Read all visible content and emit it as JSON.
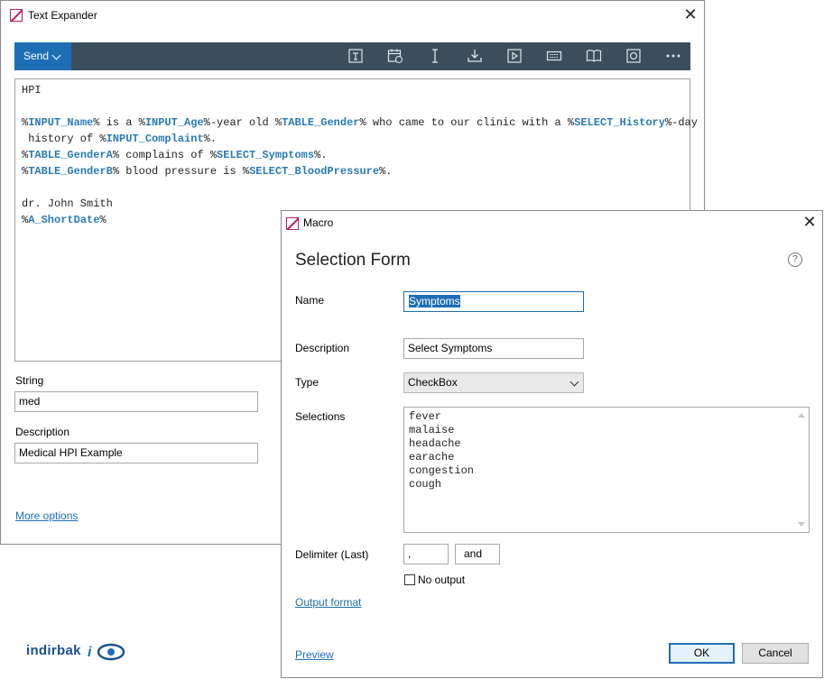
{
  "text_expander": {
    "title": "Text Expander",
    "toolbar": {
      "send_label": "Send",
      "icons": [
        "insert-field-icon",
        "insert-date-icon",
        "text-cursor-icon",
        "download-icon",
        "play-icon",
        "keyboard-icon",
        "book-icon",
        "screenshot-icon",
        "more-icon"
      ]
    },
    "editor_lines": [
      [
        {
          "t": "HPI"
        }
      ],
      [],
      [
        {
          "t": "%"
        },
        {
          "t": "INPUT_Name",
          "v": 1
        },
        {
          "t": "% is a %"
        },
        {
          "t": "INPUT_Age",
          "v": 1
        },
        {
          "t": "%-year old %"
        },
        {
          "t": "TABLE_Gender",
          "v": 1
        },
        {
          "t": "% who came to our clinic with a %"
        },
        {
          "t": "SELECT_History",
          "v": 1
        },
        {
          "t": "%-day"
        }
      ],
      [
        {
          "t": " history of %"
        },
        {
          "t": "INPUT_Complaint",
          "v": 1
        },
        {
          "t": "%."
        }
      ],
      [
        {
          "t": "%"
        },
        {
          "t": "TABLE_GenderA",
          "v": 1
        },
        {
          "t": "% complains of %"
        },
        {
          "t": "SELECT_Symptoms",
          "v": 1
        },
        {
          "t": "%."
        }
      ],
      [
        {
          "t": "%"
        },
        {
          "t": "TABLE_GenderB",
          "v": 1
        },
        {
          "t": "% blood pressure is %"
        },
        {
          "t": "SELECT_BloodPressure",
          "v": 1
        },
        {
          "t": "%."
        }
      ],
      [],
      [
        {
          "t": "dr. John Smith"
        }
      ],
      [
        {
          "t": "%"
        },
        {
          "t": "A_ShortDate",
          "v": 1
        },
        {
          "t": "%"
        }
      ]
    ],
    "string_label": "String",
    "string_value": "med",
    "description_label": "Description",
    "description_value": "Medical HPI Example",
    "more_options": "More options",
    "brand": "indirbak"
  },
  "macro": {
    "title": "Macro",
    "heading": "Selection Form",
    "help": "?",
    "name_label": "Name",
    "name_value": "Symptoms",
    "description_label": "Description",
    "description_value": "Select Symptoms",
    "type_label": "Type",
    "type_value": "CheckBox",
    "selections_label": "Selections",
    "selections": [
      "fever",
      "malaise",
      "headache",
      "earache",
      "congestion",
      "cough"
    ],
    "delimiter_label": "Delimiter (Last)",
    "delimiter_value": ",",
    "delimiter_last_value": "and",
    "no_output_label": "No output",
    "no_output_checked": false,
    "output_format": "Output format",
    "preview": "Preview",
    "ok": "OK",
    "cancel": "Cancel"
  },
  "colors": {
    "accent": "#1d6eb5",
    "toolbar": "#3c4e5c",
    "variable": "#2a7bb3",
    "app_icon": "#c21a5c"
  }
}
